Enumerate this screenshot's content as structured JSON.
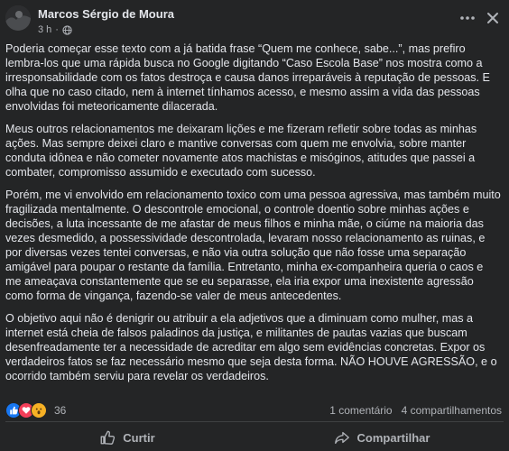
{
  "post": {
    "author": "Marcos Sérgio de Moura",
    "time": "3 h",
    "separator": "·",
    "paragraphs": [
      "Poderia começar esse texto com a já batida frase “Quem me conhece, sabe...”, mas prefiro lembra-los que uma rápida busca no Google digitando “Caso Escola Base” nos mostra como a irresponsabilidade com os fatos destroça e causa danos irreparáveis à reputação de pessoas. E olha que no caso citado, nem à internet tínhamos acesso, e mesmo assim a vida das pessoas envolvidas foi meteoricamente dilacerada.",
      "Meus outros relacionamentos me deixaram lições e me fizeram refletir sobre todas as minhas ações. Mas sempre deixei claro e mantive conversas com quem me envolvia, sobre manter conduta idônea e não cometer novamente atos machistas e misóginos, atitudes que passei a combater, compromisso assumido e executado com sucesso.",
      "Porém, me vi envolvido em relacionamento toxico com uma pessoa agressiva, mas também muito fragilizada mentalmente. O descontrole emocional, o controle doentio sobre minhas ações e decisões, a luta incessante de me afastar de meus filhos e minha mãe, o ciúme na maioria das vezes desmedido, a possessividade descontrolada, levaram nosso relacionamento as ruinas, e por diversas vezes tentei conversas, e não via outra solução que não fosse uma separação amigável para poupar o restante da família. Entretanto, minha ex-companheira queria o caos e me ameaçava constantemente que se eu separasse, ela iria expor uma inexistente agressão como forma de vingança, fazendo-se valer de meus antecedentes.",
      "O objetivo aqui não é denigrir ou atribuir a ela adjetivos que a diminuam como mulher, mas a internet está cheia de falsos paladinos da justiça, e militantes de pautas vazias que buscam desenfreadamente ter a necessidade de acreditar em algo  sem evidências concretas. Expor os verdadeiros fatos se faz necessário mesmo que seja desta forma. NÃO HOUVE AGRESSÃO, e o ocorrido também serviu para revelar os verdadeiros."
    ]
  },
  "reactions": {
    "icons": [
      "like-icon",
      "love-icon",
      "wow-icon"
    ],
    "count": "36"
  },
  "stats": {
    "comments": "1 comentário",
    "shares": "4 compartilhamentos"
  },
  "actions": {
    "curtir": "Curtir",
    "compartilhar": "Compartilhar"
  },
  "colors": {
    "background": "#242526",
    "text": "#e4e6eb",
    "secondary_text": "#b0b3b8",
    "like_blue": "#1877f2",
    "love_red": "#f33e58",
    "wow_yellow": "#f7b125"
  }
}
